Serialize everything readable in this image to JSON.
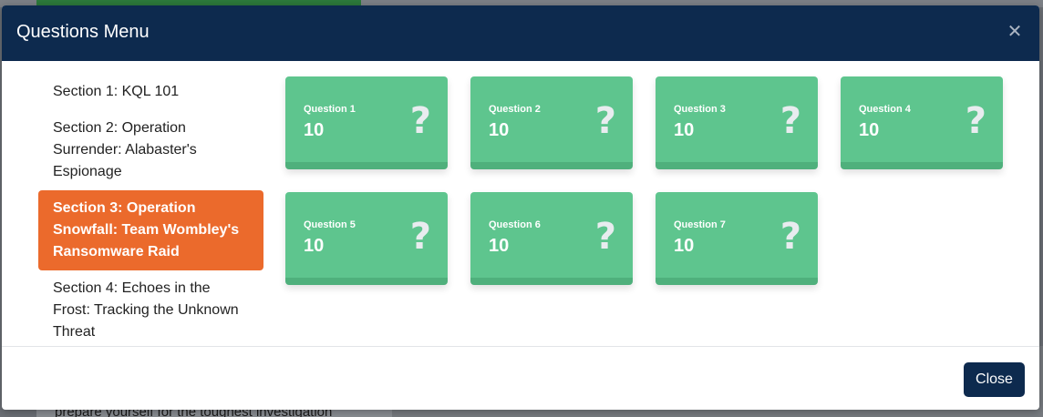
{
  "background": {
    "bottom_text": "prepare yourself for the toughest investigation"
  },
  "modal": {
    "title": "Questions Menu",
    "close_icon": "close-icon",
    "sections": [
      {
        "label": "Section 1: KQL 101",
        "active": false
      },
      {
        "label": "Section 2: Operation Surrender: Alabaster's Espionage",
        "active": false
      },
      {
        "label": "Section 3: Operation Snowfall: Team Wombley's Ransomware Raid",
        "active": true
      },
      {
        "label": "Section 4: Echoes in the Frost: Tracking the Unknown Threat",
        "active": false
      }
    ],
    "questions": [
      {
        "label": "Question 1",
        "points": "10",
        "icon": "question-mark-icon"
      },
      {
        "label": "Question 2",
        "points": "10",
        "icon": "question-mark-icon"
      },
      {
        "label": "Question 3",
        "points": "10",
        "icon": "question-mark-icon"
      },
      {
        "label": "Question 4",
        "points": "10",
        "icon": "question-mark-icon"
      },
      {
        "label": "Question 5",
        "points": "10",
        "icon": "question-mark-icon"
      },
      {
        "label": "Question 6",
        "points": "10",
        "icon": "question-mark-icon"
      },
      {
        "label": "Question 7",
        "points": "10",
        "icon": "question-mark-icon"
      }
    ],
    "footer": {
      "close_label": "Close"
    }
  },
  "colors": {
    "header": "#0d2a4e",
    "active_section": "#eb6a2c",
    "card": "#5ec58e"
  }
}
